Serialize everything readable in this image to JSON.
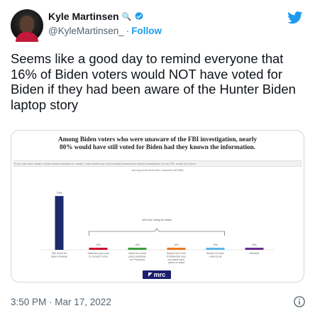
{
  "tweet": {
    "display_name": "Kyle Martinsen",
    "emoji": "🔍",
    "handle": "@KyleMartinsen_",
    "follow_label": "Follow",
    "text": "Seems like a good day to remind everyone that 16% of Biden voters would NOT have voted for Biden if they had been aware of the Hunter Biden laptop story",
    "timestamp": "3:50 PM · Mar 17, 2022"
  },
  "colors": {
    "accent": "#1d9bf0",
    "text": "#0f1419",
    "muted": "#536471"
  },
  "media": {
    "title_line1": "Among Biden voters who were unaware of the FBI investigation, nearly",
    "title_line2": "80% would have still voted for Biden had they known the information.",
    "question": "If you had been aware of this actual evidence in emails, texts, testimony and banking transactions being investigated by the FBI, would you have:",
    "subtitle": "Among those that were unaware (N1058)",
    "logo": "mrc"
  },
  "chart_data": {
    "type": "bar",
    "subtitle": "Among those that were unaware (N1058)",
    "categories": [
      "Still Voted for Biden Anyway",
      "Switched your vote to Donald Trump",
      "Voted for a third party candidate for President",
      "Stayed out of the Presidential race but voted other races on ballot",
      "Would not have voted at all",
      "Refused"
    ],
    "series": [
      {
        "values": [
          79,
          4,
          4,
          4,
          3,
          5
        ],
        "labels": [
          "79%",
          "4%",
          "4%",
          "4%",
          "3%",
          "5%"
        ],
        "colors": [
          "#1b2a6b",
          "#c8102e",
          "#3d9e3d",
          "#e87722",
          "#58b6e8",
          "#6a2c91"
        ]
      }
    ],
    "annotations": [
      {
        "text": "16% Not Voting for Biden",
        "spans": [
          1,
          4
        ]
      }
    ],
    "ylim": [
      0,
      100
    ],
    "grid": false,
    "legend": "none"
  }
}
